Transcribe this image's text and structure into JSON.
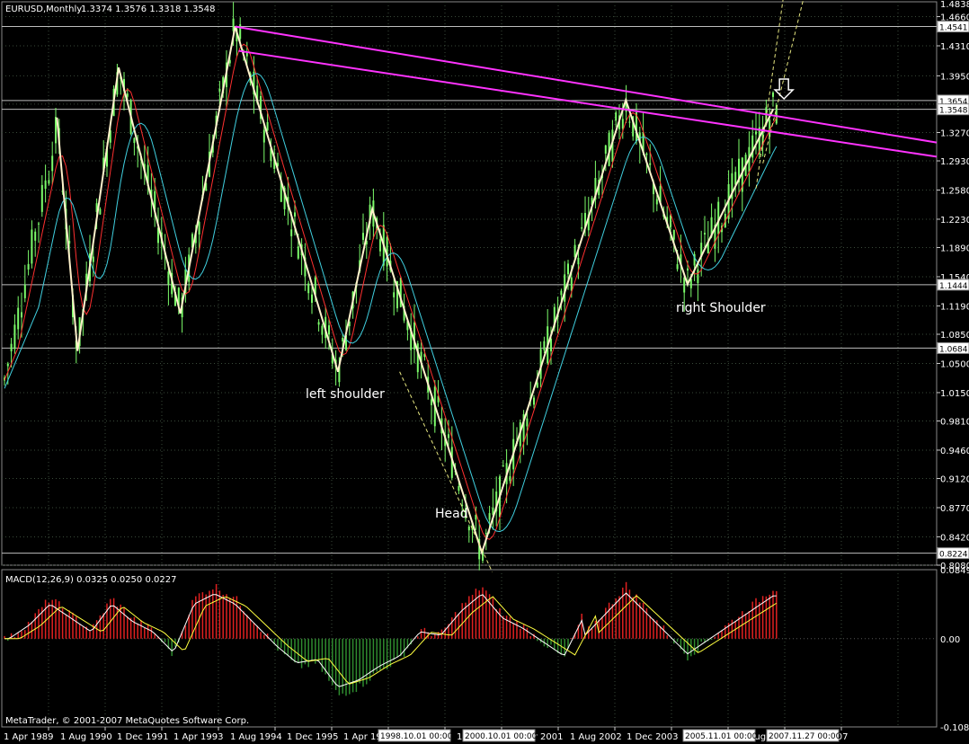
{
  "header": {
    "symbol_title": "EURUSD,Monthly",
    "ohlc": "1.3374 1.3576 1.3318 1.3548"
  },
  "macd_panel": {
    "title": "MACD(12,26,9) 0.0325 0.0250 0.0227"
  },
  "copyright": "MetaTrader, © 2001-2007 MetaQuotes Software Corp.",
  "colors": {
    "background": "#000000",
    "grid": "#3a4a3a",
    "candle": "#7cfc6a",
    "zigzag": "#fff2cc",
    "trendline": "#ff33ff",
    "ma_fast": "#ff3030",
    "ma_slow": "#40d0e0",
    "macd_pos": "#e02020",
    "macd_neg": "#2e8b2e",
    "macd_line": "#ffffff",
    "signal_line": "#ffff40"
  },
  "chart_data": [
    {
      "type": "candlestick",
      "title": "EURUSD,Monthly",
      "y_ticks": [
        "1.4660",
        "1.4310",
        "1.3950",
        "1.3610",
        "1.3270",
        "1.2930",
        "1.2580",
        "1.2230",
        "1.1890",
        "1.1540",
        "1.1190",
        "1.0850",
        "1.0500",
        "1.0150",
        "0.9810",
        "0.9460",
        "0.9120",
        "0.8770",
        "0.8420",
        "0.8080"
      ],
      "y_top_label": "1.4838",
      "ylim": [
        0.808,
        1.4838
      ],
      "price_tags": [
        {
          "label": "1.4541",
          "value": 1.4541
        },
        {
          "label": "1.3654",
          "value": 1.3654
        },
        {
          "label": "1.3548",
          "value": 1.3548
        },
        {
          "label": "1.1444",
          "value": 1.1444
        },
        {
          "label": "1.0684",
          "value": 1.0684
        },
        {
          "label": "0.8224",
          "value": 0.8224
        }
      ],
      "x_labels": [
        "1 Apr 1989",
        "1 Aug 1990",
        "1 Dec 1991",
        "1 Apr 1993",
        "1 Aug 1994",
        "1 Dec 1995",
        "1 Apr 1997",
        "1 Aug 1998",
        "1 Dec 1999",
        "1 Apr 2001",
        "1 Aug 2002",
        "1 Dec 2003",
        "1 Apr 2005",
        "1 Aug 2006",
        "1 Dec 2007"
      ],
      "x_markers": [
        "1998.10.01 00:00",
        "2000.10.01 00:00",
        "2005.11.01 00:00",
        "2007.11.27 00:00"
      ],
      "annotations": [
        "left shoulder",
        "Head",
        "right Shoulder"
      ],
      "zigzag": [
        {
          "date": "1990.06",
          "price": 1.345
        },
        {
          "date": "1990.12",
          "price": 1.065
        },
        {
          "date": "1991.12",
          "price": 1.405
        },
        {
          "date": "1993.06",
          "price": 1.11
        },
        {
          "date": "1994.10",
          "price": 1.454
        },
        {
          "date": "1997.04",
          "price": 1.04
        },
        {
          "date": "1998.02",
          "price": 1.235
        },
        {
          "date": "2000.10",
          "price": 0.823
        },
        {
          "date": "2004.04",
          "price": 1.366
        },
        {
          "date": "2005.10",
          "price": 1.145
        },
        {
          "date": "2007.11",
          "price": 1.355
        }
      ],
      "trendlines": [
        {
          "from": {
            "date": "1994.10",
            "price": 1.454
          },
          "to": {
            "date": "2008.11",
            "price": 1.315
          }
        },
        {
          "from": {
            "date": "1994.11",
            "price": 1.425
          },
          "to": {
            "date": "2008.11",
            "price": 1.298
          }
        }
      ]
    },
    {
      "type": "bar",
      "title": "MACD(12,26,9) 0.0325 0.0250 0.0227",
      "y_ticks": [
        "0.0849",
        "0.00",
        "-0.1086"
      ],
      "ylim": [
        -0.1086,
        0.0849
      ],
      "series": [
        {
          "name": "MACD",
          "values": [
            0.0,
            0.02,
            0.05,
            0.03,
            0.01,
            0.05,
            0.025,
            0.01,
            -0.02,
            0.05,
            0.065,
            0.05,
            0.02,
            -0.01,
            -0.035,
            -0.03,
            -0.07,
            -0.06,
            -0.04,
            -0.025,
            0.01,
            0.005,
            0.04,
            0.065,
            0.03,
            0.015,
            -0.005,
            -0.025,
            0.035
          ],
          "x": [
            "1989.04",
            "1989.10",
            "1990.04",
            "1990.10",
            "1991.04",
            "1991.10",
            "1992.04",
            "1992.10",
            "1993.04",
            "1993.10",
            "1994.04",
            "1994.10",
            "1995.04",
            "1995.10",
            "1996.04",
            "1996.10",
            "1997.04",
            "1997.10",
            "1998.04",
            "1998.10",
            "1999.04",
            "1999.10",
            "2000.04",
            "2000.10",
            "2001.04",
            "2001.10",
            "2002.04",
            "2002.10",
            "2003.04"
          ]
        }
      ]
    }
  ]
}
